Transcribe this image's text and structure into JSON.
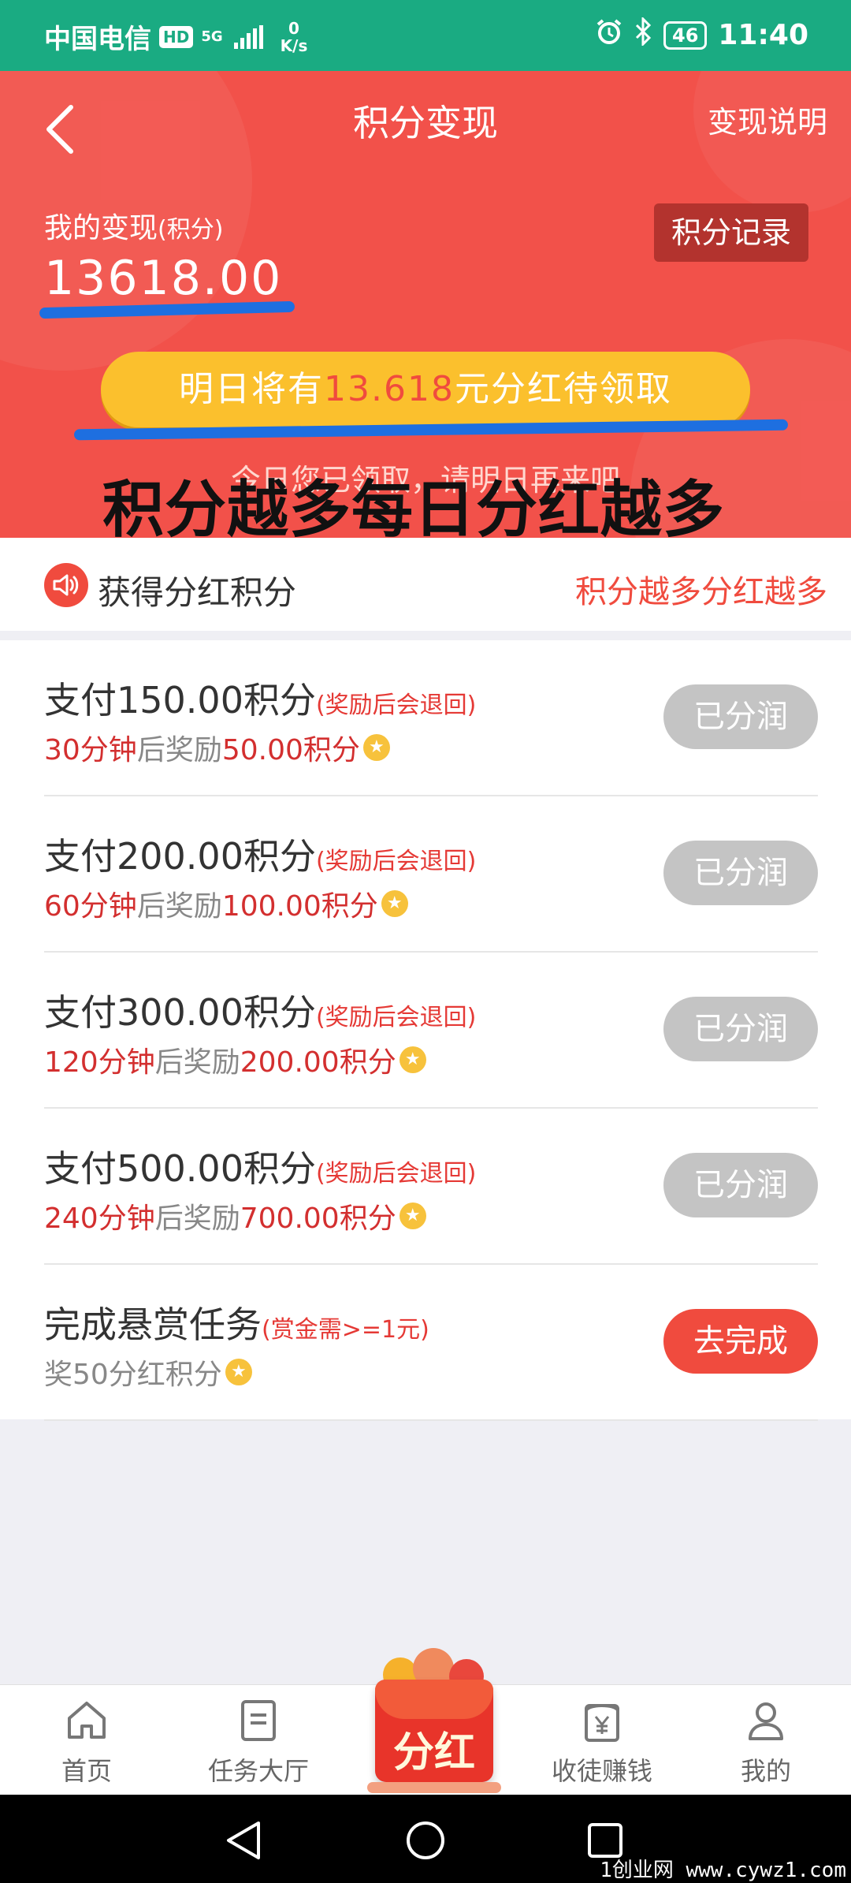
{
  "status_bar": {
    "carrier": "中国电信",
    "hd": "HD",
    "net": "5G",
    "speed_value": "0",
    "speed_unit": "K/s",
    "battery": "46",
    "time": "11:40"
  },
  "header": {
    "title": "积分变现",
    "explain_link": "变现说明",
    "my_label": "我的变现",
    "my_label_unit": "(积分)",
    "my_value": "13618.00",
    "record_button": "积分记录",
    "tomorrow_prefix": "明日将有",
    "tomorrow_amount": "13.618",
    "tomorrow_suffix": "元分红待领取",
    "status_message": "今日您已领取，请明日再来吧",
    "overlay_text": "积分越多每日分红越多"
  },
  "notice": {
    "title": "获得分红积分",
    "slogan": "积分越多分红越多"
  },
  "tasks": [
    {
      "title": "支付150.00积分",
      "note": "(奖励后会退回)",
      "time": "30分钟",
      "mid": "后奖励",
      "reward": "50.00积分",
      "button": "已分润"
    },
    {
      "title": "支付200.00积分",
      "note": "(奖励后会退回)",
      "time": "60分钟",
      "mid": "后奖励",
      "reward": "100.00积分",
      "button": "已分润"
    },
    {
      "title": "支付300.00积分",
      "note": "(奖励后会退回)",
      "time": "120分钟",
      "mid": "后奖励",
      "reward": "200.00积分",
      "button": "已分润"
    },
    {
      "title": "支付500.00积分",
      "note": "(奖励后会退回)",
      "time": "240分钟",
      "mid": "后奖励",
      "reward": "700.00积分",
      "button": "已分润"
    }
  ],
  "bounty_task": {
    "title": "完成悬赏任务",
    "note": "(赏金需>=1元)",
    "sub": "奖50分红积分",
    "button": "去完成"
  },
  "bottom_nav": {
    "home": "首页",
    "task_hall": "任务大厅",
    "dividend": "分红",
    "recruit": "收徒赚钱",
    "mine": "我的"
  },
  "watermark": "1创业网 www.cywz1.com",
  "colors": {
    "status_bar": "#1aab82",
    "header_red": "#f2514a",
    "accent_red": "#f04b3e",
    "pill_yellow": "#fbc02d",
    "disabled_gray": "#c4c4c4"
  }
}
